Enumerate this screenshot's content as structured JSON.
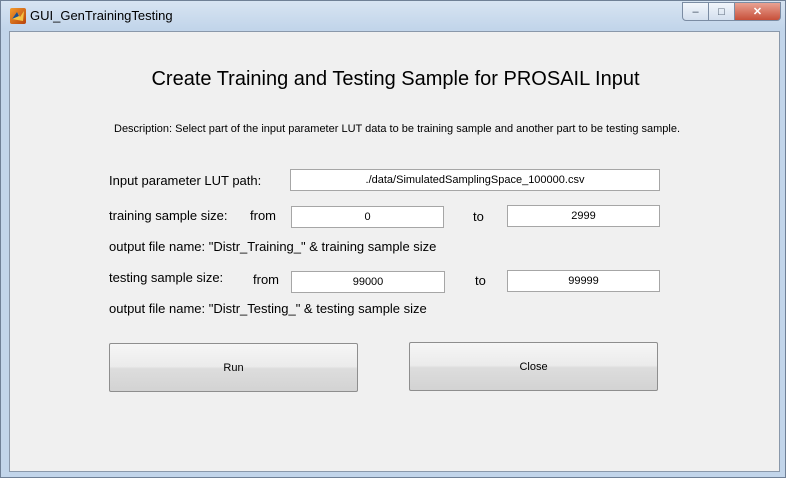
{
  "window": {
    "title": "GUI_GenTrainingTesting",
    "controls": {
      "minimize": "–",
      "maximize": "□",
      "close": "✕"
    }
  },
  "heading": "Create Training and Testing Sample for PROSAIL Input",
  "description": "Description: Select part of the input parameter LUT data to be training sample and another part to be testing sample.",
  "lut": {
    "label": "Input parameter LUT path:",
    "path": "./data/SimulatedSamplingSpace_100000.csv"
  },
  "training": {
    "label": "training sample size:",
    "from_label": "from",
    "from_value": "0",
    "to_label": "to",
    "to_value": "2999",
    "output_note": "output file name: \"Distr_Training_\" & training sample size"
  },
  "testing": {
    "label": "testing sample size:",
    "from_label": "from",
    "from_value": "99000",
    "to_label": "to",
    "to_value": "99999",
    "output_note": "output file name: \"Distr_Testing_\" & testing sample size"
  },
  "buttons": {
    "run": "Run",
    "close": "Close"
  }
}
